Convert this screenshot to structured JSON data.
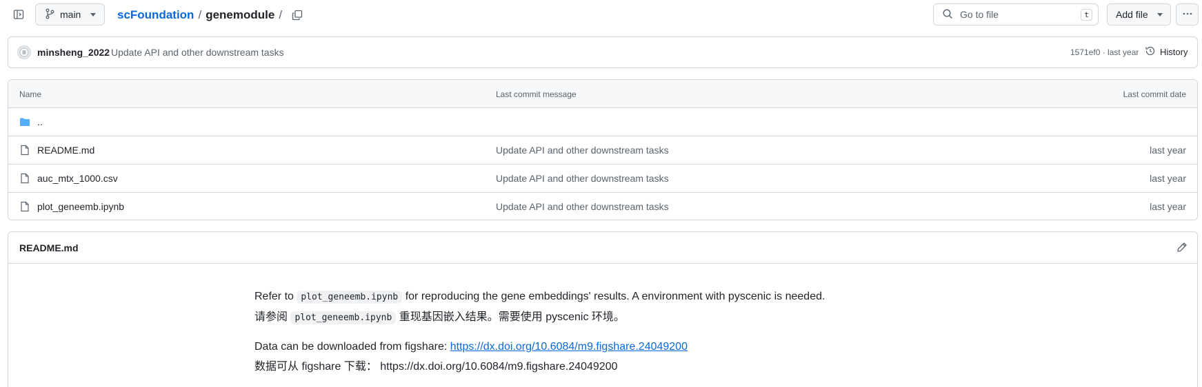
{
  "repo": {
    "owner_repo": "scFoundation",
    "path": "genemodule",
    "separator": "/",
    "branch": "main"
  },
  "search": {
    "placeholder": "Go to file",
    "shortcut": "t"
  },
  "toolbar": {
    "add_file_label": "Add file"
  },
  "commit": {
    "author": "minsheng_2022",
    "message": "Update API and other downstream tasks",
    "meta": "1571ef0 · last year",
    "history_label": "History"
  },
  "file_table": {
    "headers": [
      "Name",
      "Last commit message",
      "Last commit date"
    ],
    "parent": "..",
    "rows": [
      {
        "name": "README.md",
        "message": "Update API and other downstream tasks",
        "date": "last year"
      },
      {
        "name": "auc_mtx_1000.csv",
        "message": "Update API and other downstream tasks",
        "date": "last year"
      },
      {
        "name": "plot_geneemb.ipynb",
        "message": "Update API and other downstream tasks",
        "date": "last year"
      }
    ]
  },
  "readme": {
    "title": "README.md",
    "line1_pre": "Refer to ",
    "line1_code": "plot_geneemb.ipynb",
    "line1_post": " for reproducing the gene embeddings' results. A environment with pyscenic is needed.",
    "line2_pre": "请参阅 ",
    "line2_code": "plot_geneemb.ipynb",
    "line2_post": " 重现基因嵌入结果。需要使用 pyscenic 环境。",
    "line3_pre": "Data can be downloaded from figshare: ",
    "line3_link": "https://dx.doi.org/10.6084/m9.figshare.24049200",
    "line4": "数据可从 figshare 下载： https://dx.doi.org/10.6084/m9.figshare.24049200"
  },
  "colors": {
    "link": "#0969da",
    "folder": "#54aeff",
    "muted": "#59636e",
    "border": "#d0d7de"
  },
  "icons": [
    "sidebar-toggle-icon",
    "branch-icon",
    "copy-icon",
    "search-icon",
    "kebab-icon",
    "history-icon",
    "folder-icon",
    "file-icon",
    "pencil-icon"
  ]
}
